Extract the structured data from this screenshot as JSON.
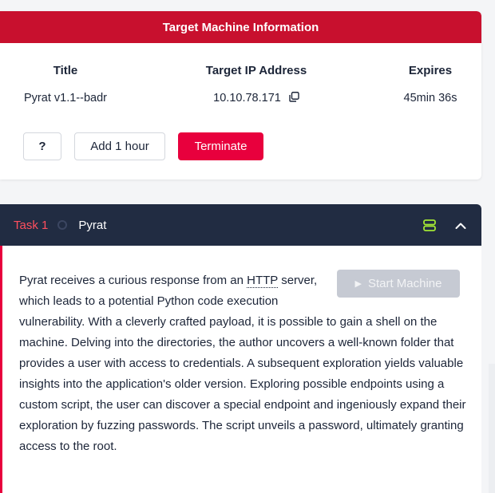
{
  "machine_card": {
    "header": "Target Machine Information",
    "columns": [
      {
        "head": "Title",
        "value": "Pyrat v1.1--badr"
      },
      {
        "head": "Target IP Address",
        "value": "10.10.78.171"
      },
      {
        "head": "Expires",
        "value": "45min 36s"
      }
    ],
    "buttons": {
      "help": "?",
      "add_hour": "Add 1 hour",
      "terminate": "Terminate"
    },
    "icons": {
      "copy": "copy-icon"
    }
  },
  "task": {
    "number": "Task 1",
    "name": "Pyrat",
    "start_button": "Start Machine",
    "description_pre": "Pyrat receives a curious response from an ",
    "description_abbr": "HTTP",
    "description_post": " server, which leads to a potential Python code execution vulnerability. With a cleverly crafted payload, it is possible to gain a shell on the machine. Delving into the directories, the author uncovers a well-known folder that provides a user with access to credentials. A subsequent exploration yields valuable insights into the application's older version. Exploring possible endpoints using a custom script, the user can discover a special endpoint and ingeniously expand their exploration by fuzzing passwords. The script unveils a password, ultimately granting access to the root.",
    "icons": {
      "server": "server-icon",
      "collapse": "chevron-up-icon"
    }
  },
  "colors": {
    "header_red": "#c8102e",
    "accent_red": "#e8003d",
    "task_bar": "#212c42",
    "server_icon_green": "#a3e635"
  }
}
